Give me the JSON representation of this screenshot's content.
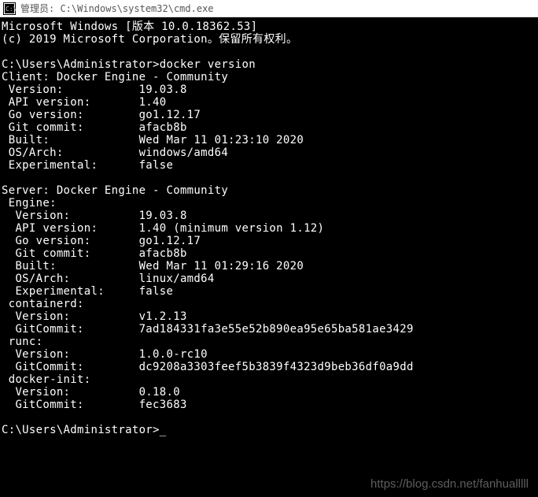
{
  "titlebar": {
    "text": "管理员: C:\\Windows\\system32\\cmd.exe"
  },
  "terminal": {
    "lines": [
      "Microsoft Windows [版本 10.0.18362.53]",
      "(c) 2019 Microsoft Corporation。保留所有权利。",
      "",
      "C:\\Users\\Administrator>docker version",
      "Client: Docker Engine - Community",
      " Version:           19.03.8",
      " API version:       1.40",
      " Go version:        go1.12.17",
      " Git commit:        afacb8b",
      " Built:             Wed Mar 11 01:23:10 2020",
      " OS/Arch:           windows/amd64",
      " Experimental:      false",
      "",
      "Server: Docker Engine - Community",
      " Engine:",
      "  Version:          19.03.8",
      "  API version:      1.40 (minimum version 1.12)",
      "  Go version:       go1.12.17",
      "  Git commit:       afacb8b",
      "  Built:            Wed Mar 11 01:29:16 2020",
      "  OS/Arch:          linux/amd64",
      "  Experimental:     false",
      " containerd:",
      "  Version:          v1.2.13",
      "  GitCommit:        7ad184331fa3e55e52b890ea95e65ba581ae3429",
      " runc:",
      "  Version:          1.0.0-rc10",
      "  GitCommit:        dc9208a3303feef5b3839f4323d9beb36df0a9dd",
      " docker-init:",
      "  Version:          0.18.0",
      "  GitCommit:        fec3683",
      "",
      "C:\\Users\\Administrator>"
    ],
    "cursor": "_"
  },
  "watermark": {
    "text": "https://blog.csdn.net/fanhualllll"
  }
}
